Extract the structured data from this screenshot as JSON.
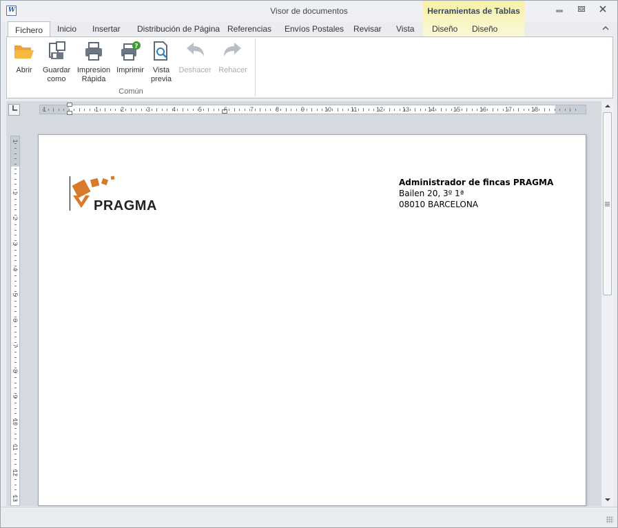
{
  "window": {
    "title": "Visor de documentos",
    "contextual_tab_title": "Herramientas de Tablas"
  },
  "ribbon_tabs": [
    "Fichero",
    "Inicio",
    "Insertar",
    "Distribución de Página",
    "Referencias",
    "Envíos Postales",
    "Revisar",
    "Vista",
    "Diseño",
    "Diseño"
  ],
  "ribbon": {
    "buttons": [
      {
        "label": "Abrir",
        "icon": "folder-open-icon",
        "enabled": true
      },
      {
        "label": "Guardar\ncomo",
        "icon": "save-as-icon",
        "enabled": true
      },
      {
        "label": "Impresion\nRápida",
        "icon": "quick-print-icon",
        "enabled": true
      },
      {
        "label": "Imprimir",
        "icon": "print-icon",
        "enabled": true
      },
      {
        "label": "Vista\nprevia",
        "icon": "print-preview-icon",
        "enabled": true
      },
      {
        "label": "Deshacer",
        "icon": "undo-icon",
        "enabled": false
      },
      {
        "label": "Rehacer",
        "icon": "redo-icon",
        "enabled": false
      }
    ],
    "group_label": "Común"
  },
  "ruler": {
    "horizontal_labels": [
      "1",
      "1",
      "2",
      "3",
      "4",
      "5",
      "6",
      "7",
      "8",
      "9",
      "10",
      "11",
      "12",
      "13",
      "14",
      "15",
      "16",
      "17",
      "18"
    ],
    "vertical_labels": [
      "1",
      "1",
      "2",
      "3",
      "4",
      "5",
      "6",
      "7",
      "8",
      "9",
      "10",
      "11",
      "12",
      "13"
    ]
  },
  "document": {
    "logo_text": "PRAGMA",
    "address_lines": [
      "Administrador de fincas PRAGMA",
      "Bailen 20, 3º 1ª",
      "08010 BARCELONA"
    ]
  },
  "colors": {
    "logo_orange": "#d97a2b",
    "contextual_tab": "#f6f0a6"
  }
}
